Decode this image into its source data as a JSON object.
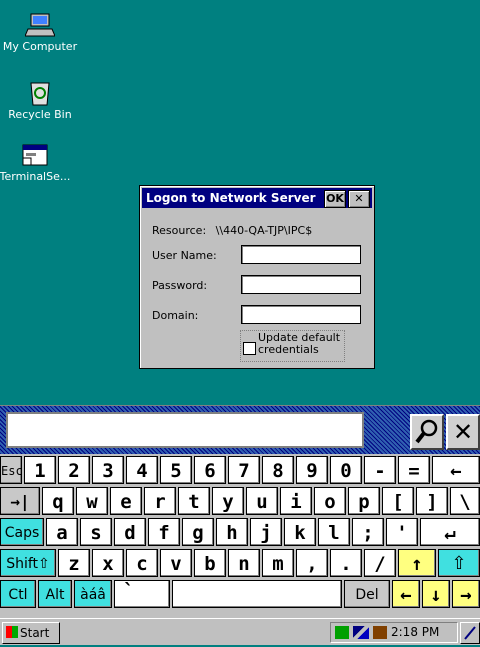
{
  "desktop": {
    "icons": [
      {
        "label": "My Computer",
        "icon": "computer-icon"
      },
      {
        "label": "Recycle Bin",
        "icon": "recycle-bin-icon"
      },
      {
        "label": "TerminalSe...",
        "icon": "terminal-services-icon"
      }
    ]
  },
  "dialog": {
    "title": "Logon to Network Server",
    "ok_label": "OK",
    "close_label": "✕",
    "resource_label": "Resource:",
    "resource_value": "\\\\440-QA-TJP\\IPC$",
    "user_name_label": "User Name:",
    "password_label": "Password:",
    "domain_label": "Domain:",
    "update_label": "Update default credentials",
    "user_name_value": "",
    "password_value": "",
    "domain_value": ""
  },
  "keyboard": {
    "close_label": "✕",
    "row1": [
      "Esc",
      "1",
      "2",
      "3",
      "4",
      "5",
      "6",
      "7",
      "8",
      "9",
      "0",
      "-",
      "=",
      "←"
    ],
    "row2": [
      "→|",
      "q",
      "w",
      "e",
      "r",
      "t",
      "y",
      "u",
      "i",
      "o",
      "p",
      "[",
      "]",
      "\\"
    ],
    "row3": [
      "Caps",
      "a",
      "s",
      "d",
      "f",
      "g",
      "h",
      "j",
      "k",
      "l",
      ";",
      "'",
      "↵"
    ],
    "row4": [
      "Shift⇧",
      "z",
      "x",
      "c",
      "v",
      "b",
      "n",
      "m",
      ",",
      ".",
      "/",
      "↑",
      "⇧"
    ],
    "row5": [
      "Ctl",
      "Alt",
      "àáâ",
      "`",
      " ",
      "Del",
      "←",
      "↓",
      "→"
    ]
  },
  "taskbar": {
    "start_label": "Start",
    "clock": "2:18 PM"
  },
  "colors": {
    "desktop": "#008080",
    "title_bar": "#000080",
    "key_cyan": "#40e0e0",
    "key_yellow": "#ffff80"
  }
}
